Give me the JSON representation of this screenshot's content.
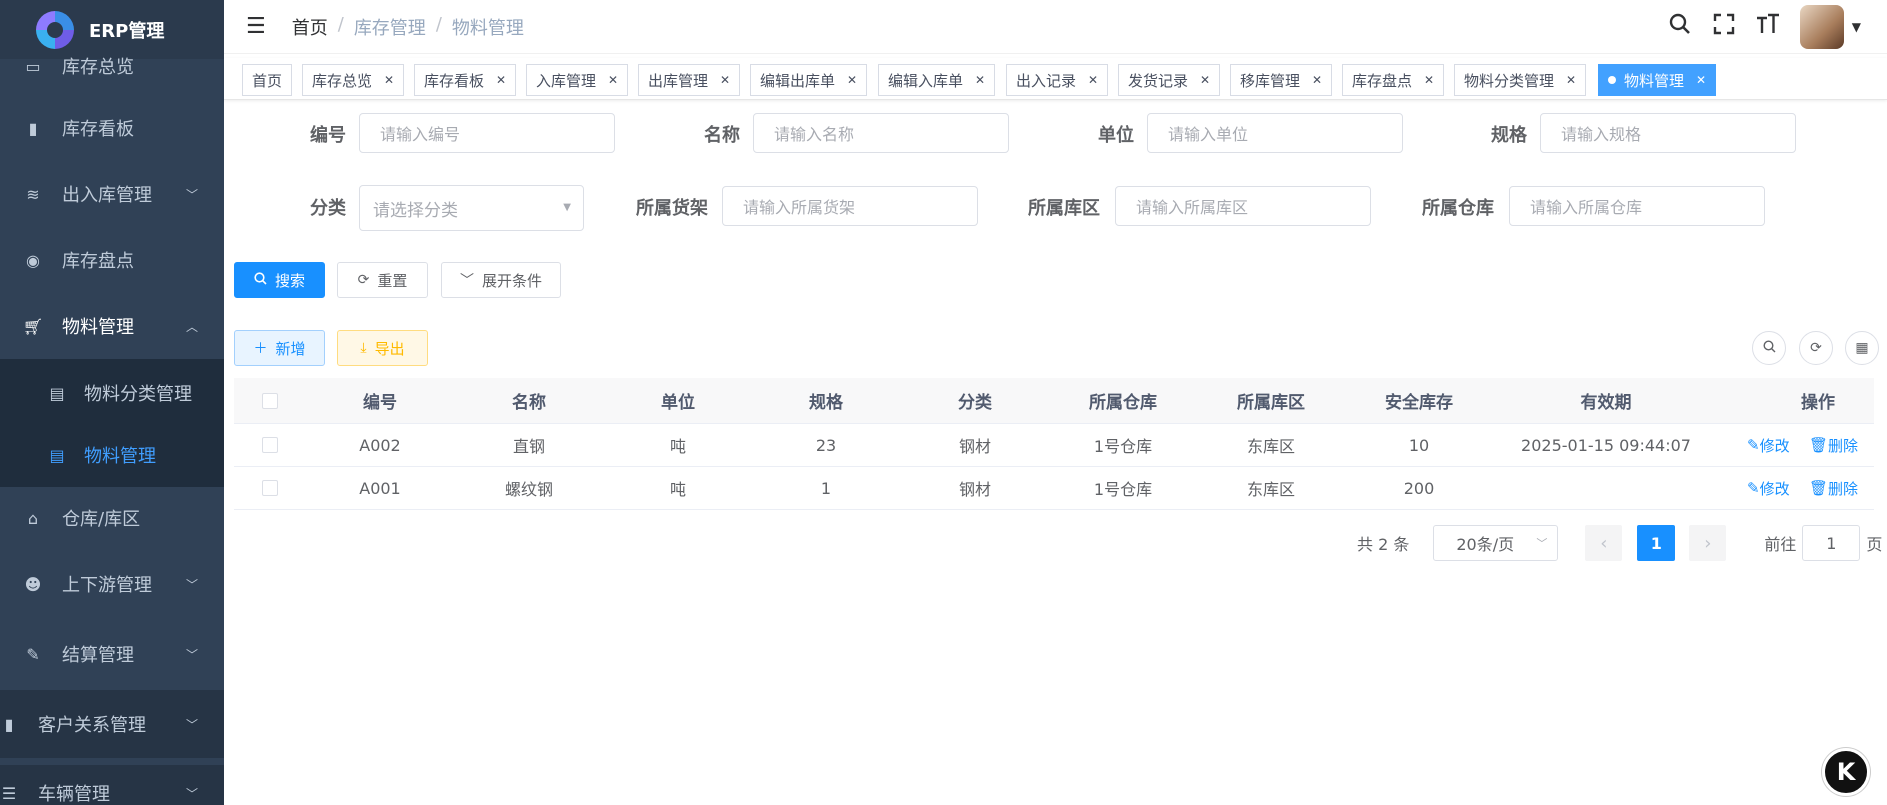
{
  "app": {
    "title": "ERP管理"
  },
  "sidebar": {
    "items": [
      {
        "label": "库存总览",
        "icon": "monitor-icon"
      },
      {
        "label": "库存看板",
        "icon": "bar-chart-icon"
      },
      {
        "label": "出入库管理",
        "icon": "layers-icon"
      },
      {
        "label": "库存盘点",
        "icon": "target-icon"
      },
      {
        "label": "物料管理",
        "icon": "cart-icon"
      },
      {
        "label": "物料分类管理",
        "icon": "doc-icon"
      },
      {
        "label": "物料管理",
        "icon": "doc-icon"
      },
      {
        "label": "仓库/库区",
        "icon": "warehouse-icon"
      },
      {
        "label": "上下游管理",
        "icon": "people-icon"
      },
      {
        "label": "结算管理",
        "icon": "edit-icon"
      },
      {
        "label": "客户关系管理",
        "icon": "bar-chart-icon"
      },
      {
        "label": "车辆管理",
        "icon": "list-icon"
      }
    ]
  },
  "header": {
    "breadcrumb": [
      "首页",
      "库存管理",
      "物料管理"
    ]
  },
  "tags": [
    "首页",
    "库存总览",
    "库存看板",
    "入库管理",
    "出库管理",
    "编辑出库单",
    "编辑入库单",
    "出入记录",
    "发货记录",
    "移库管理",
    "库存盘点",
    "物料分类管理",
    "物料管理"
  ],
  "search_form": {
    "fields": [
      {
        "label": "编号",
        "placeholder": "请输入编号"
      },
      {
        "label": "名称",
        "placeholder": "请输入名称"
      },
      {
        "label": "单位",
        "placeholder": "请输入单位"
      },
      {
        "label": "规格",
        "placeholder": "请输入规格"
      },
      {
        "label": "分类",
        "placeholder": "请选择分类"
      },
      {
        "label": "所属货架",
        "placeholder": "请输入所属货架"
      },
      {
        "label": "所属库区",
        "placeholder": "请输入所属库区"
      },
      {
        "label": "所属仓库",
        "placeholder": "请输入所属仓库"
      }
    ],
    "buttons": {
      "search": "搜索",
      "reset": "重置",
      "expand": "展开条件"
    }
  },
  "toolbar": {
    "add": "新增",
    "export": "导出"
  },
  "table": {
    "columns": [
      "编号",
      "名称",
      "单位",
      "规格",
      "分类",
      "所属仓库",
      "所属库区",
      "安全库存",
      "有效期",
      "操作"
    ],
    "rows": [
      {
        "code": "A002",
        "name": "直钢",
        "unit": "吨",
        "spec": "23",
        "category": "钢材",
        "warehouse": "1号仓库",
        "zone": "东库区",
        "safety_stock": "10",
        "expiry": "2025-01-15 09:44:07"
      },
      {
        "code": "A001",
        "name": "螺纹钢",
        "unit": "吨",
        "spec": "1",
        "category": "钢材",
        "warehouse": "1号仓库",
        "zone": "东库区",
        "safety_stock": "200",
        "expiry": ""
      }
    ],
    "actions": {
      "edit": "修改",
      "delete": "删除"
    }
  },
  "pagination": {
    "total": "共 2 条",
    "page_size": "20条/页",
    "current_page": "1",
    "goto_prefix": "前往",
    "goto_value": "1",
    "goto_suffix": "页"
  },
  "fab_label": "K"
}
